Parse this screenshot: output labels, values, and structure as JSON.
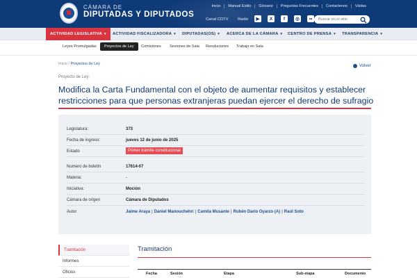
{
  "header": {
    "brand_line1": "CÁMARA DE",
    "brand_line2": "DIPUTADAS Y DIPUTADOS",
    "top_links": [
      "Inicio",
      "Manual Estilo",
      "Glosario",
      "Preguntas Frecuentes",
      "Contactenos",
      "Visitas"
    ],
    "canal_tv": "Canal CDTV",
    "radio": "Radio",
    "social_icons": [
      "youtube-icon",
      "x-icon",
      "facebook-icon",
      "instagram-icon",
      "flickr-icon"
    ],
    "search_placeholder": "Buscar en el sitio",
    "colors": {
      "brand": "#0f3a78",
      "accent": "#d93540"
    }
  },
  "nav": {
    "items": [
      {
        "label": "ACTIVIDAD LEGISLATIVA",
        "active": true
      },
      {
        "label": "ACTIVIDAD FISCALIZADORA",
        "active": false
      },
      {
        "label": "DIPUTADAS(OS)",
        "active": false
      },
      {
        "label": "ACERCA DE LA CÁMARA",
        "active": false
      },
      {
        "label": "CENTRO DE PRENSA",
        "active": false
      },
      {
        "label": "TRANSPARENCIA",
        "active": false
      }
    ]
  },
  "subnav": {
    "items": [
      {
        "label": "Leyes Promulgadas",
        "active": false
      },
      {
        "label": "Proyectos de Ley",
        "active": true
      },
      {
        "label": "Comisiones",
        "active": false
      },
      {
        "label": "Sesiones de Sala",
        "active": false
      },
      {
        "label": "Resoluciones",
        "active": false
      },
      {
        "label": "Trabajo en Sala",
        "active": false
      }
    ]
  },
  "breadcrumb": {
    "home": "Inicio",
    "sep": " / ",
    "current": "Proyectos de Ley"
  },
  "back_label": "Volver",
  "page": {
    "eyebrow": "Proyecto de Ley:",
    "title": "Modifica la Carta Fundamental con el objeto de aumentar requisitos y establecer restricciones para que personas extranjeras puedan ejercer el derecho de sufragio"
  },
  "details": {
    "legislatura": {
      "label": "Legislatura:",
      "value": "373"
    },
    "fecha": {
      "label": "Fecha de ingreso:",
      "value": "jueves 12 de junio de 2025"
    },
    "estado": {
      "label": "Estado",
      "value": "Primer trámite constitucional"
    },
    "boletin": {
      "label": "Numero de boletín",
      "value": "17614-07"
    },
    "materia": {
      "label": "Materia:",
      "value": "-"
    },
    "iniciativa": {
      "label": "Iniciativa:",
      "value": "Moción"
    },
    "origen": {
      "label": "Cámara de origen",
      "value": "Cámara de Diputados"
    },
    "autor": {
      "label": "Autor",
      "authors": [
        "Jaime Araya",
        "Daniel Manouchehri",
        "Camila Musante",
        "Rubén Darío Oyarzo (A)",
        "Raúl Soto"
      ]
    }
  },
  "sidebar": {
    "items": [
      {
        "label": "Tramitación",
        "active": true
      },
      {
        "label": "Informes",
        "active": false
      },
      {
        "label": "Oficios",
        "active": false
      }
    ]
  },
  "section": {
    "title": "Tramitación",
    "columns": [
      "Fecha",
      "Sesión",
      "Etapa",
      "Sub-etapa",
      "Documento"
    ]
  }
}
